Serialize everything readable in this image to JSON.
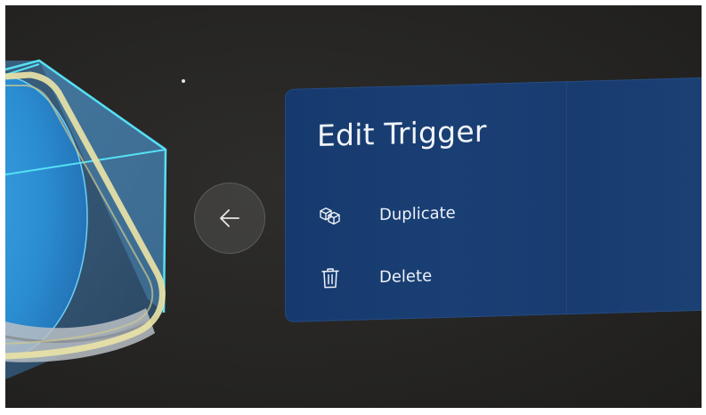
{
  "panel": {
    "title": "Edit Trigger",
    "items": [
      {
        "label": "Duplicate",
        "icon": "duplicate-cubes-icon"
      },
      {
        "label": "Delete",
        "icon": "trash-icon"
      }
    ]
  },
  "back_button": {
    "icon": "arrow-left-icon"
  },
  "colors": {
    "background": "#262523",
    "panel": "#193c70",
    "hologram_edge": "#55e0f4",
    "trigger_outline": "#e8e2a6"
  }
}
